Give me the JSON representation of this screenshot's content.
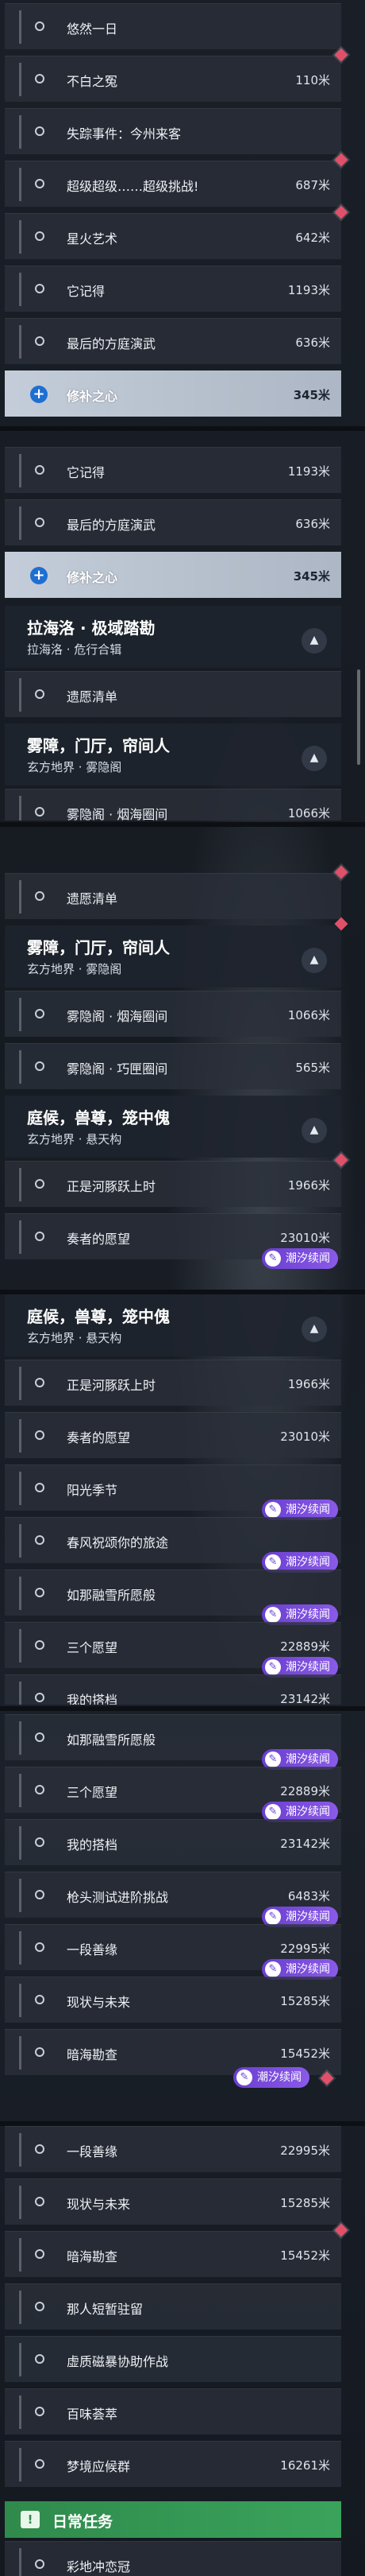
{
  "badge_label": "潮汐续闻",
  "colors": {
    "accent_blue": "#1f6fd1",
    "badge_purple": "#7a4ce0",
    "marker_red": "#e0506a",
    "daily_green": "#3aa35b"
  },
  "screen1": {
    "rows": [
      {
        "name": "悠然一日",
        "dist": ""
      },
      {
        "name": "不白之冤",
        "dist": "110米"
      },
      {
        "name": "失踪事件：今州来客",
        "dist": ""
      },
      {
        "name": "超级超级……超级挑战!",
        "dist": "687米"
      },
      {
        "name": "星火艺术",
        "dist": "642米"
      },
      {
        "name": "它记得",
        "dist": "1193米"
      },
      {
        "name": "最后的方庭演武",
        "dist": "636米"
      },
      {
        "name": "修补之心",
        "dist": "345米"
      }
    ]
  },
  "screen2": {
    "rows_top": [
      {
        "name": "它记得",
        "dist": "1193米"
      },
      {
        "name": "最后的方庭演武",
        "dist": "636米"
      },
      {
        "name": "修补之心",
        "dist": "345米"
      }
    ],
    "header1": {
      "title": "拉海洛 · 极域踏勘",
      "sub": "拉海洛 · 危行合辑"
    },
    "row_a": {
      "name": "遗愿清单",
      "dist": ""
    },
    "header2": {
      "title": "雾障，门厅，帘间人",
      "sub": "玄方地界 · 雾隐阁"
    },
    "row_b": {
      "name": "雾隐阁 · 烟海圈间",
      "dist": "1066米"
    }
  },
  "screen3": {
    "row_a": {
      "name": "遗愿清单",
      "dist": ""
    },
    "header1": {
      "title": "雾障，门厅，帘间人",
      "sub": "玄方地界 · 雾隐阁"
    },
    "rows_b": [
      {
        "name": "雾隐阁 · 烟海圈间",
        "dist": "1066米"
      },
      {
        "name": "雾隐阁 · 巧匣圈间",
        "dist": "565米"
      }
    ],
    "header2": {
      "title": "庭候，兽尊，笼中傀",
      "sub": "玄方地界 · 悬天构"
    },
    "rows_c": [
      {
        "name": "正是河豚跃上时",
        "dist": "1966米"
      },
      {
        "name": "奏者的愿望",
        "dist": "23010米"
      }
    ]
  },
  "screen4": {
    "header1": {
      "title": "庭候，兽尊，笼中傀",
      "sub": "玄方地界 · 悬天构"
    },
    "rows": [
      {
        "name": "正是河豚跃上时",
        "dist": "1966米"
      },
      {
        "name": "奏者的愿望",
        "dist": "23010米"
      },
      {
        "name": "阳光季节",
        "dist": ""
      },
      {
        "name": "春风祝颂你的旅途",
        "dist": ""
      },
      {
        "name": "如那融雪所愿般",
        "dist": ""
      },
      {
        "name": "三个愿望",
        "dist": "22889米"
      },
      {
        "name": "我的搭档",
        "dist": "23142米"
      }
    ]
  },
  "screen5": {
    "rows": [
      {
        "name": "如那融雪所愿般",
        "dist": ""
      },
      {
        "name": "三个愿望",
        "dist": "22889米"
      },
      {
        "name": "我的搭档",
        "dist": "23142米"
      },
      {
        "name": "枪头测试进阶挑战",
        "dist": "6483米"
      },
      {
        "name": "一段善缘",
        "dist": "22995米"
      },
      {
        "name": "现状与未来",
        "dist": "15285米"
      },
      {
        "name": "暗海勘查",
        "dist": "15452米"
      }
    ]
  },
  "screen6": {
    "rows": [
      {
        "name": "一段善缘",
        "dist": "22995米"
      },
      {
        "name": "现状与未来",
        "dist": "15285米"
      },
      {
        "name": "暗海勘查",
        "dist": "15452米"
      },
      {
        "name": "那人短暂驻留",
        "dist": ""
      },
      {
        "name": "虚质磁暴协助作战",
        "dist": ""
      },
      {
        "name": "百味荟萃",
        "dist": ""
      },
      {
        "name": "梦境应候群",
        "dist": "16261米"
      }
    ],
    "daily": {
      "title": "日常任务",
      "icon": "!"
    },
    "cut_row": {
      "name": "彩地冲恋冠",
      "dist": ""
    }
  }
}
